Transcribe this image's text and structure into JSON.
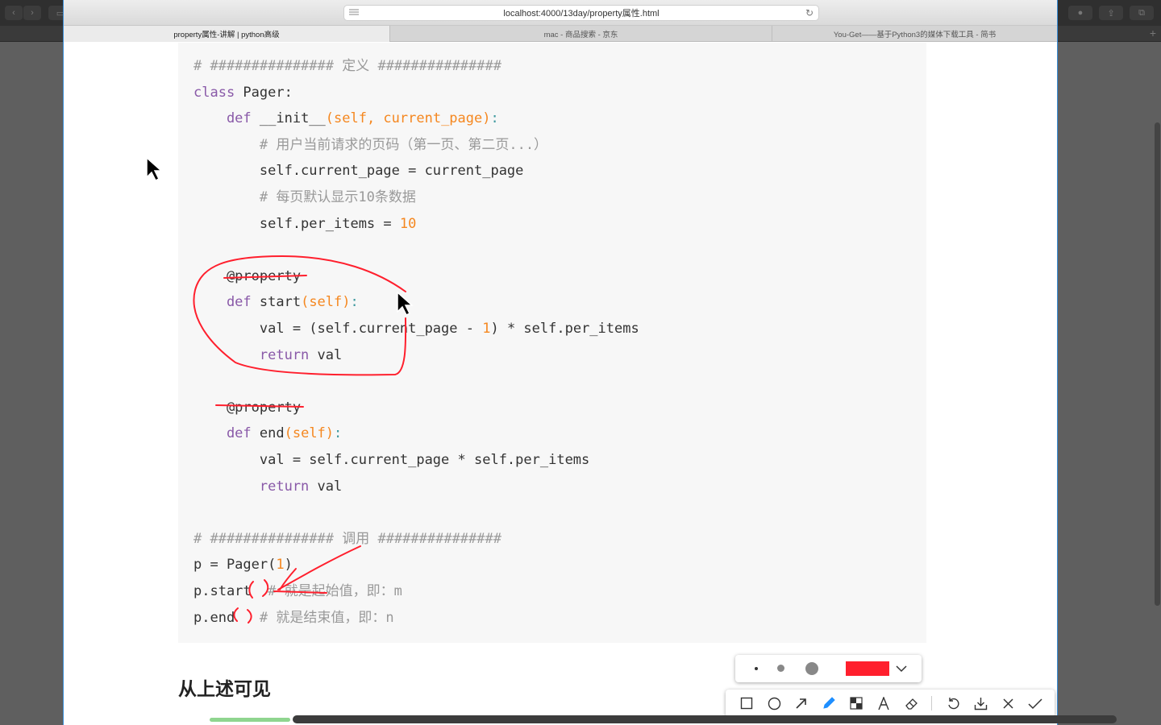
{
  "browser": {
    "url": "localhost:4000/13day/property属性.html",
    "tabs": [
      {
        "label": "property属性-讲解 | python高级",
        "active": true
      },
      {
        "label": "mac - 商品搜索 - 京东",
        "active": false
      },
      {
        "label": "You-Get——基于Python3的媒体下载工具 - 简书",
        "active": false
      }
    ]
  },
  "code": {
    "lines": [
      {
        "segments": [
          {
            "t": "# ############### 定义 ###############",
            "c": "c"
          }
        ]
      },
      {
        "segments": [
          {
            "t": "class ",
            "c": "k"
          },
          {
            "t": "Pager",
            "c": "n"
          },
          {
            "t": ":",
            "c": "n"
          }
        ]
      },
      {
        "segments": [
          {
            "t": "    def ",
            "c": "k"
          },
          {
            "t": "__init__",
            "c": "n"
          },
          {
            "t": "(self, current_page)",
            "c": "o"
          },
          {
            "t": ":",
            "c": "p"
          }
        ]
      },
      {
        "segments": [
          {
            "t": "        # 用户当前请求的页码（第一页、第二页...）",
            "c": "c"
          }
        ]
      },
      {
        "segments": [
          {
            "t": "        self.current_page = current_page",
            "c": "n"
          }
        ]
      },
      {
        "segments": [
          {
            "t": "        # 每页默认显示10条数据",
            "c": "c"
          }
        ]
      },
      {
        "segments": [
          {
            "t": "        self.per_items = ",
            "c": "n"
          },
          {
            "t": "10",
            "c": "o"
          }
        ]
      },
      {
        "segments": [
          {
            "t": "",
            "c": "n"
          }
        ]
      },
      {
        "segments": [
          {
            "t": "    @property",
            "c": "n"
          }
        ]
      },
      {
        "segments": [
          {
            "t": "    def ",
            "c": "k"
          },
          {
            "t": "start",
            "c": "n"
          },
          {
            "t": "(self)",
            "c": "o"
          },
          {
            "t": ":",
            "c": "p"
          }
        ]
      },
      {
        "segments": [
          {
            "t": "        val = (self.current_page - ",
            "c": "n"
          },
          {
            "t": "1",
            "c": "o"
          },
          {
            "t": ") * self.per_items",
            "c": "n"
          }
        ]
      },
      {
        "segments": [
          {
            "t": "        return ",
            "c": "k"
          },
          {
            "t": "val",
            "c": "n"
          }
        ]
      },
      {
        "segments": [
          {
            "t": "",
            "c": "n"
          }
        ]
      },
      {
        "segments": [
          {
            "t": "    @property",
            "c": "n"
          }
        ]
      },
      {
        "segments": [
          {
            "t": "    def ",
            "c": "k"
          },
          {
            "t": "end",
            "c": "n"
          },
          {
            "t": "(self)",
            "c": "o"
          },
          {
            "t": ":",
            "c": "p"
          }
        ]
      },
      {
        "segments": [
          {
            "t": "        val = self.current_page * self.per_items",
            "c": "n"
          }
        ]
      },
      {
        "segments": [
          {
            "t": "        return ",
            "c": "k"
          },
          {
            "t": "val",
            "c": "n"
          }
        ]
      },
      {
        "segments": [
          {
            "t": "",
            "c": "n"
          }
        ]
      },
      {
        "segments": [
          {
            "t": "# ############### 调用 ###############",
            "c": "c"
          }
        ]
      },
      {
        "segments": [
          {
            "t": "p = Pager(",
            "c": "n"
          },
          {
            "t": "1",
            "c": "o"
          },
          {
            "t": ")",
            "c": "n"
          }
        ]
      },
      {
        "segments": [
          {
            "t": "p.start  ",
            "c": "n"
          },
          {
            "t": "# 就是起始值，即：m",
            "c": "c"
          }
        ]
      },
      {
        "segments": [
          {
            "t": "p.end   ",
            "c": "n"
          },
          {
            "t": "# 就是结束值，即：n",
            "c": "c"
          }
        ]
      }
    ]
  },
  "heading": "从上述可见",
  "annotation_color": "#ff1f2d",
  "screenshot_tool": {
    "sizes": [
      "small-dot",
      "medium-dot",
      "large-dot"
    ],
    "selected_color": "#ff1f2d",
    "tools": [
      "rectangle",
      "ellipse",
      "arrow",
      "pen",
      "mosaic",
      "text",
      "eraser",
      "undo",
      "save",
      "cancel",
      "confirm"
    ],
    "selected_tool": "pen"
  }
}
